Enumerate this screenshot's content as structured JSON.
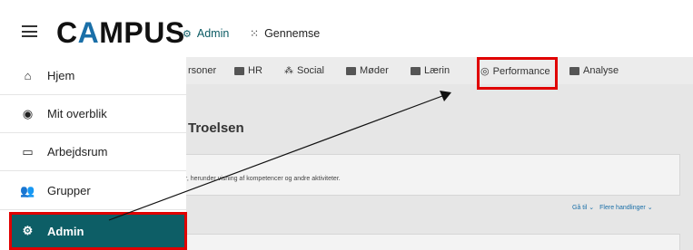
{
  "header": {
    "logo_pre": "C",
    "logo_accent": "A",
    "logo_post": "MPUS",
    "admin_label": "Admin",
    "browse_label": "Gennemse"
  },
  "subnav": {
    "items": [
      "rsoner",
      "HR",
      "Social",
      "Møder",
      "Lærin",
      "Performance",
      "Analyse"
    ]
  },
  "sidebar": {
    "items": [
      {
        "label": "Hjem",
        "icon": "home-icon"
      },
      {
        "label": "Mit overblik",
        "icon": "account-circle-icon"
      },
      {
        "label": "Arbejdsrum",
        "icon": "workspace-icon"
      },
      {
        "label": "Grupper",
        "icon": "groups-icon"
      },
      {
        "label": "Admin",
        "icon": "admin-icon"
      }
    ]
  },
  "main": {
    "title": "Troelsen",
    "card_text": "er, herunder visning af kompetencer og andre aktiviteter.",
    "goto_label": "Gå til",
    "more_actions_label": "Flere handlinger"
  },
  "colors": {
    "brand_teal": "#0d5e66",
    "highlight_red": "#e00000",
    "accent_blue": "#1a6fa8"
  }
}
